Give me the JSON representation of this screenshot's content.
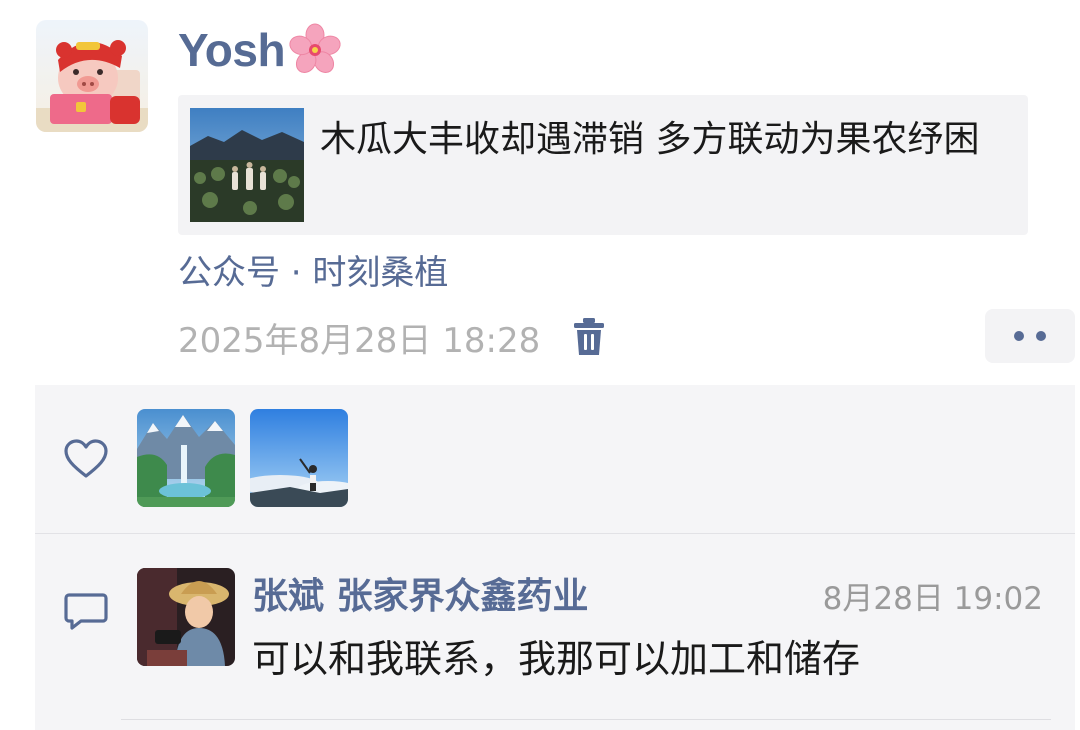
{
  "post": {
    "author_name": "Yosh",
    "author_emoji": "🌸",
    "avatar_icon": "cartoon-pig-avatar",
    "article": {
      "title": "木瓜大丰收却遇滞销 多方联动为果农纾困",
      "thumbnail_icon": "mountain-field-photo"
    },
    "source": "公众号 · 时刻桑植",
    "timestamp": "2025年8月28日 18:28",
    "delete_icon": "trash-icon",
    "more_icon": "more-dots-icon"
  },
  "likes": {
    "icon": "heart-icon",
    "users": [
      {
        "avatar_icon": "waterfall-landscape-avatar"
      },
      {
        "avatar_icon": "girl-on-mountain-avatar"
      }
    ]
  },
  "comments": [
    {
      "icon": "comment-bubble-icon",
      "author": "张斌  张家界众鑫药业",
      "time": "8月28日 19:02",
      "text": "可以和我联系，我那可以加工和储存",
      "avatar_icon": "child-with-hat-avatar"
    }
  ],
  "colors": {
    "link_blue": "#576b95",
    "timestamp_gray": "#b2b2b2",
    "panel_bg": "#f5f5f7",
    "card_bg": "#f3f3f5"
  }
}
